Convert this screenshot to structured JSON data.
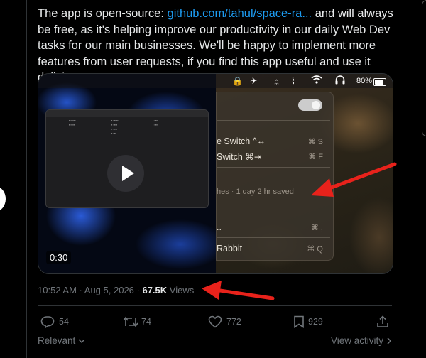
{
  "tweet": {
    "text_before_link": "The app is open-source: ",
    "link_text": "github.com/tahul/space-ra...",
    "text_after_link": " and will always be free, as it's helping improve our productivity in our daily Web Dev tasks for our main businesses. We'll be happy to implement more features from user requests, if you find this app useful and use it daily!"
  },
  "video": {
    "duration": "0:30",
    "menubar": {
      "battery_percent": "80%"
    },
    "dropdown": {
      "items": [
        {
          "label": "e Switch ^↔",
          "shortcut": "⌘ S"
        },
        {
          "label": "Switch ⌘⇥",
          "shortcut": "⌘ F"
        },
        {
          "label": "hes · 1 day 2 hr saved",
          "shortcut": ""
        },
        {
          "label": "..",
          "shortcut": "⌘ ,"
        },
        {
          "label": "Rabbit",
          "shortcut": "⌘ Q"
        }
      ]
    }
  },
  "meta": {
    "time": "10:52 AM",
    "date": "Aug 5, 2026",
    "views_count": "67.5K",
    "views_label": "Views"
  },
  "actions": {
    "replies": "54",
    "reposts": "74",
    "likes": "772",
    "bookmarks": "929"
  },
  "footer": {
    "sort_label": "Relevant",
    "view_activity": "View activity"
  },
  "colors": {
    "link": "#1d9bf0",
    "muted": "#71767b",
    "arrow": "#e8221b"
  }
}
